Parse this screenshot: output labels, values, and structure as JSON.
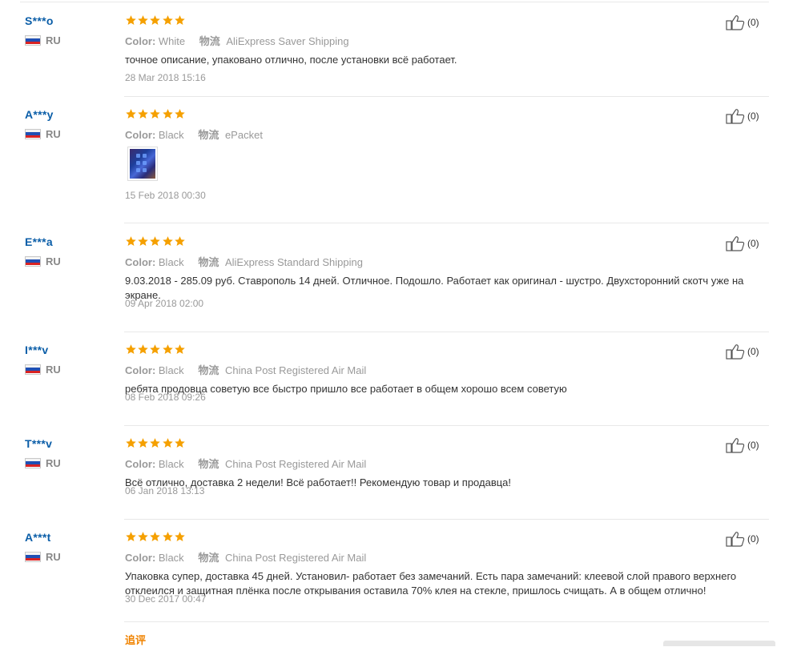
{
  "reviews": [
    {
      "user": "S***o",
      "country": "RU",
      "stars": 5,
      "color_label": "Color:",
      "color_value": "White",
      "shipping_label": "物流",
      "shipping_value": "AliExpress Saver Shipping",
      "text": "точное описание, упаковано отлично, после установки всё работает.",
      "date": "28 Mar 2018 15:16",
      "helpful_count": "(0)",
      "has_photo": false
    },
    {
      "user": "A***y",
      "country": "RU",
      "stars": 5,
      "color_label": "Color:",
      "color_value": "Black",
      "shipping_label": "物流",
      "shipping_value": "ePacket",
      "text": "",
      "date": "15 Feb 2018 00:30",
      "helpful_count": "(0)",
      "has_photo": true
    },
    {
      "user": "E***a",
      "country": "RU",
      "stars": 5,
      "color_label": "Color:",
      "color_value": "Black",
      "shipping_label": "物流",
      "shipping_value": "AliExpress Standard Shipping",
      "text": "9.03.2018 - 285.09 руб. Ставрополь 14 дней. Отличное. Подошло. Работает как оригинал - шустро. Двухсторонний скотч уже на экране.",
      "date": "09 Apr 2018 02:00",
      "helpful_count": "(0)",
      "has_photo": false
    },
    {
      "user": "I***v",
      "country": "RU",
      "stars": 5,
      "color_label": "Color:",
      "color_value": "Black",
      "shipping_label": "物流",
      "shipping_value": "China Post Registered Air Mail",
      "text": "ребята продовца советую все быстро пришло все работает в общем хорошо всем советую",
      "date": "08 Feb 2018 09:26",
      "helpful_count": "(0)",
      "has_photo": false
    },
    {
      "user": "T***v",
      "country": "RU",
      "stars": 5,
      "color_label": "Color:",
      "color_value": "Black",
      "shipping_label": "物流",
      "shipping_value": "China Post Registered Air Mail",
      "text": "Всё отлично, доставка 2 недели! Всё работает!! Рекомендую товар и продавца!",
      "date": "06 Jan 2018 13:13",
      "helpful_count": "(0)",
      "has_photo": false
    },
    {
      "user": "A***t",
      "country": "RU",
      "stars": 5,
      "color_label": "Color:",
      "color_value": "Black",
      "shipping_label": "物流",
      "shipping_value": "China Post Registered Air Mail",
      "text": "Упаковка супер, доставка 45 дней. Установил- работает без замечаний. Есть пара замечаний: клеевой слой правого верхнего отклеился и защитная плёнка после открывания оставила 70% клея на стекле, пришлось счищать. А в общем отлично!",
      "date": "30 Dec 2017 00:47",
      "helpful_count": "(0)",
      "has_photo": false
    }
  ],
  "followup_label": "追评",
  "colors": {
    "username": "#0b5ea8",
    "star": "#f5a000",
    "muted": "#999999",
    "followup": "#f08300"
  },
  "icons": {
    "star": "star-icon",
    "thumb": "thumbs-up-icon",
    "flag": "russia-flag-icon"
  }
}
